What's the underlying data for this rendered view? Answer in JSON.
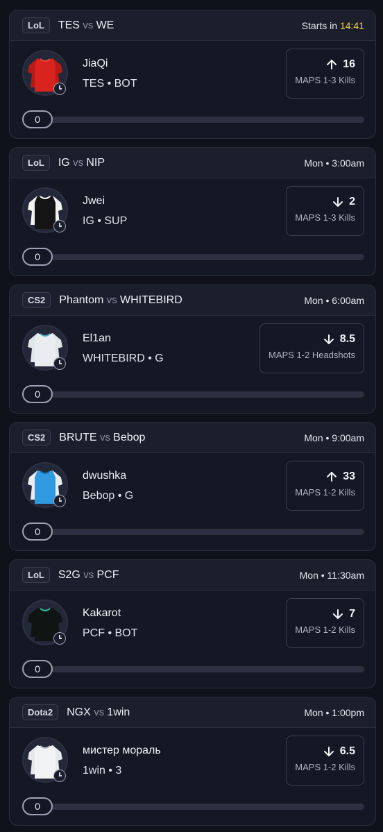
{
  "cards": [
    {
      "league": "LoL",
      "team_a": "TES",
      "vs": "vs",
      "team_b": "WE",
      "time_prefix": "Starts in ",
      "time_highlight": "14:41",
      "player": "JiaQi",
      "team_pos": "TES • BOT",
      "direction": "up",
      "line": "16",
      "stat_label": "MAPS 1-3 Kills",
      "progress": "0",
      "jersey": "red"
    },
    {
      "league": "LoL",
      "team_a": "IG",
      "vs": "vs",
      "team_b": "NIP",
      "time_prefix": "Mon • 3:00am",
      "time_highlight": "",
      "player": "Jwei",
      "team_pos": "IG • SUP",
      "direction": "down",
      "line": "2",
      "stat_label": "MAPS 1-3 Kills",
      "progress": "0",
      "jersey": "white-black"
    },
    {
      "league": "CS2",
      "team_a": "Phantom",
      "vs": "vs",
      "team_b": "WHITEBIRD",
      "time_prefix": "Mon • 6:00am",
      "time_highlight": "",
      "player": "El1an",
      "team_pos": "WHITEBIRD • G",
      "direction": "down",
      "line": "8.5",
      "stat_label": "MAPS 1-2 Headshots",
      "progress": "0",
      "jersey": "white-teal"
    },
    {
      "league": "CS2",
      "team_a": "BRUTE",
      "vs": "vs",
      "team_b": "Bebop",
      "time_prefix": "Mon • 9:00am",
      "time_highlight": "",
      "player": "dwushka",
      "team_pos": "Bebop • G",
      "direction": "up",
      "line": "33",
      "stat_label": "MAPS 1-2 Kills",
      "progress": "0",
      "jersey": "blue"
    },
    {
      "league": "LoL",
      "team_a": "S2G",
      "vs": "vs",
      "team_b": "PCF",
      "time_prefix": "Mon • 11:30am",
      "time_highlight": "",
      "player": "Kakarot",
      "team_pos": "PCF • BOT",
      "direction": "down",
      "line": "7",
      "stat_label": "MAPS 1-2 Kills",
      "progress": "0",
      "jersey": "black-green"
    },
    {
      "league": "Dota2",
      "team_a": "NGX",
      "vs": "vs",
      "team_b": "1win",
      "time_prefix": "Mon • 1:00pm",
      "time_highlight": "",
      "player": "мистер мораль",
      "team_pos": "1win • 3",
      "direction": "down",
      "line": "6.5",
      "stat_label": "MAPS 1-2 Kills",
      "progress": "0",
      "jersey": "white"
    }
  ],
  "colors": {
    "background": "#0f121b",
    "card": "#141824",
    "card_header": "#1b1f2c",
    "highlight": "#f5d33a",
    "track": "#2c3040"
  },
  "jerseys": {
    "red": {
      "body": "#d8231e",
      "sleeve": "#b81a17",
      "trim": "#e94a3f"
    },
    "white-black": {
      "body": "#141414",
      "sleeve": "#f2f2f2",
      "trim": "#ffffff"
    },
    "white-teal": {
      "body": "#e9edf0",
      "sleeve": "#dfe6ea",
      "trim": "#4aa3b8"
    },
    "blue": {
      "body": "#2f9ae0",
      "sleeve": "#e9ecf0",
      "trim": "#1b6aa8"
    },
    "black-green": {
      "body": "#0e1512",
      "sleeve": "#0e1512",
      "trim": "#27c49a"
    },
    "white": {
      "body": "#f2f3f5",
      "sleeve": "#e6e8eb",
      "trim": "#b9bec6"
    }
  }
}
